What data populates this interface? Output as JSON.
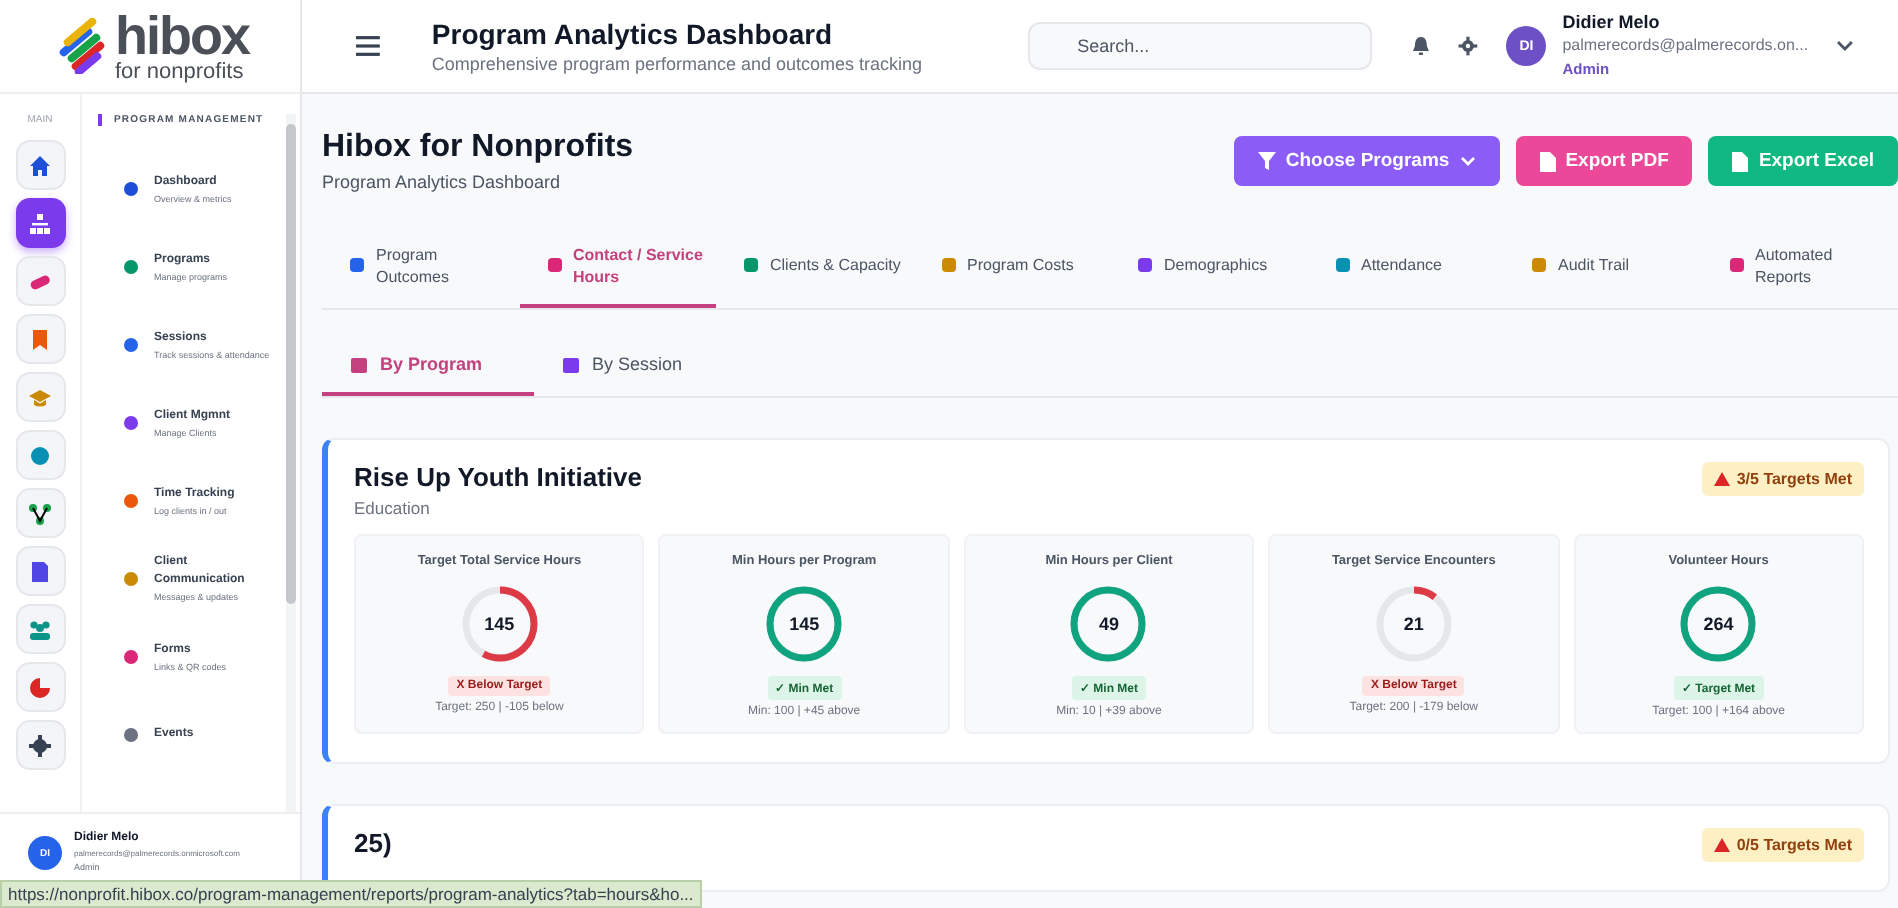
{
  "logo": {
    "name": "hibox",
    "tagline": "for nonprofits"
  },
  "rail": {
    "label": "MAIN",
    "items": [
      {
        "kind": "home",
        "color": "#1d4ed8",
        "selected": false
      },
      {
        "kind": "org",
        "color": "#7c3aed",
        "selected": true
      },
      {
        "kind": "pill",
        "color": "#db2777",
        "selected": false
      },
      {
        "kind": "bookmark",
        "color": "#ea580c",
        "selected": false
      },
      {
        "kind": "cap",
        "color": "#ca8a04",
        "selected": false
      },
      {
        "kind": "dot",
        "color": "#0891b2",
        "selected": false
      },
      {
        "kind": "nodes",
        "color": "#16a34a",
        "selected": false
      },
      {
        "kind": "doc",
        "color": "#4f46e5",
        "selected": false
      },
      {
        "kind": "people",
        "color": "#0d9488",
        "selected": false
      },
      {
        "kind": "pie",
        "color": "#dc2626",
        "selected": false
      },
      {
        "kind": "gear",
        "color": "#374151",
        "selected": false
      }
    ]
  },
  "submenu": {
    "title": "PROGRAM MANAGEMENT",
    "items": [
      {
        "label": "Dashboard",
        "sub": "Overview & metrics",
        "color": "#1d4ed8"
      },
      {
        "label": "Programs",
        "sub": "Manage programs",
        "color": "#059669"
      },
      {
        "label": "Sessions",
        "sub": "Track sessions & attendance",
        "color": "#2563eb"
      },
      {
        "label": "Client Mgmnt",
        "sub": "Manage Clients",
        "color": "#7c3aed"
      },
      {
        "label": "Time Tracking",
        "sub": "Log clients in / out",
        "color": "#ea580c"
      },
      {
        "label": "Client Communication",
        "sub": "Messages & updates",
        "color": "#ca8a04"
      },
      {
        "label": "Forms",
        "sub": "Links & QR codes",
        "color": "#db2777"
      },
      {
        "label": "Events",
        "color": "#6b7280"
      }
    ]
  },
  "sidebar_user": {
    "initials": "DI",
    "name": "Didier Melo",
    "email": "palmerecords@palmerecords.onmicrosoft.com",
    "role": "Admin"
  },
  "header": {
    "title": "Program Analytics Dashboard",
    "subtitle": "Comprehensive program performance and outcomes tracking",
    "search": {
      "placeholder": "Search..."
    },
    "user": {
      "initials": "DI",
      "name": "Didier Melo",
      "email": "palmerecords@palmerecords.on...",
      "role": "Admin"
    }
  },
  "page": {
    "title": "Hibox for Nonprofits",
    "subtitle": "Program Analytics Dashboard",
    "buttons": [
      {
        "kind": "filter",
        "label": "Choose Programs"
      },
      {
        "kind": "pdf",
        "label": "Export PDF"
      },
      {
        "kind": "excel",
        "label": "Export Excel"
      }
    ]
  },
  "tabs": [
    {
      "label": "Program Outcomes",
      "color": "#2563eb",
      "selected": false
    },
    {
      "label": "Contact / Service Hours",
      "color": "#db2777",
      "selected": true
    },
    {
      "label": "Clients & Capacity",
      "color": "#059669",
      "selected": false
    },
    {
      "label": "Program Costs",
      "color": "#ca8a04",
      "selected": false
    },
    {
      "label": "Demographics",
      "color": "#7c3aed",
      "selected": false
    },
    {
      "label": "Attendance",
      "color": "#0891b2",
      "selected": false
    },
    {
      "label": "Audit Trail",
      "color": "#ca8a04",
      "selected": false
    },
    {
      "label": "Automated Reports",
      "color": "#db2777",
      "selected": false
    }
  ],
  "subtabs": [
    {
      "label": "By Program",
      "selected": true
    },
    {
      "label": "By Session",
      "selected": false
    }
  ],
  "programs": [
    {
      "title": "Rise Up Youth Initiative",
      "category": "Education",
      "badge": "3/5 Targets Met",
      "metrics": [
        {
          "title": "Target Total Service Hours",
          "value": "145",
          "level": 0.58,
          "kind": "below",
          "status_label": "X Below Target",
          "detail": "Target: 250 | -105 below"
        },
        {
          "title": "Min Hours per Program",
          "value": "145",
          "level": 1,
          "kind": "met",
          "status_label": "✓ Min Met",
          "detail": "Min: 100 | +45 above"
        },
        {
          "title": "Min Hours per Client",
          "value": "49",
          "level": 1,
          "kind": "met",
          "status_label": "✓ Min Met",
          "detail": "Min: 10 | +39 above"
        },
        {
          "title": "Target Service Encounters",
          "value": "21",
          "level": 0.105,
          "kind": "below",
          "status_label": "X Below Target",
          "detail": "Target: 200 | -179 below"
        },
        {
          "title": "Volunteer Hours",
          "value": "264",
          "level": 1,
          "kind": "met",
          "status_label": "✓ Target Met",
          "detail": "Target: 100 | +164 above"
        }
      ]
    },
    {
      "title": "25)",
      "badge": "0/5 Targets Met"
    }
  ],
  "status_bar": {
    "url": "https://nonprofit.hibox.co/program-management/reports/program-analytics?tab=hours&ho..."
  }
}
